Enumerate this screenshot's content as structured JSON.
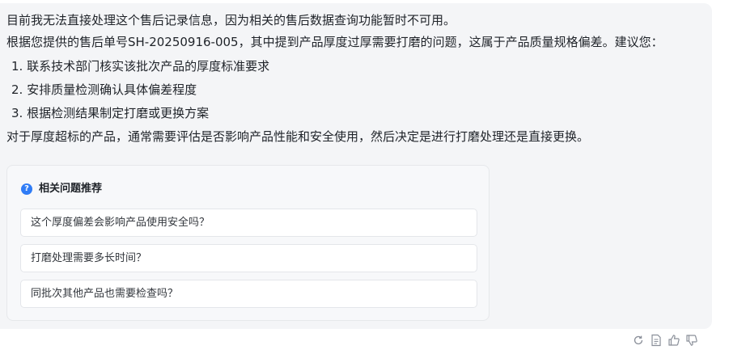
{
  "message": {
    "line1": "目前我无法直接处理这个售后记录信息，因为相关的售后数据查询功能暂时不可用。",
    "line2": "根据您提供的售后单号SH-20250916-005，其中提到产品厚度过厚需要打磨的问题，这属于产品质量规格偏差。建议您：",
    "steps": [
      "1. 联系技术部门核实该批次产品的厚度标准要求",
      "2. 安排质量检测确认具体偏差程度",
      "3. 根据检测结果制定打磨或更换方案"
    ],
    "conclusion": "对于厚度超标的产品，通常需要评估是否影响产品性能和安全使用，然后决定是进行打磨处理还是直接更换。"
  },
  "recommendations": {
    "icon": "question-circle-icon",
    "title": "相关问题推荐",
    "items": [
      "这个厚度偏差会影响产品使用安全吗？",
      "打磨处理需要多长时间？",
      "同批次其他产品也需要检查吗？"
    ]
  },
  "actions": [
    "refresh-icon",
    "document-icon",
    "thumbs-up-icon",
    "thumbs-down-icon"
  ],
  "colors": {
    "bubble_bg": "#f4f5f7",
    "accent": "#2f7cf6"
  }
}
